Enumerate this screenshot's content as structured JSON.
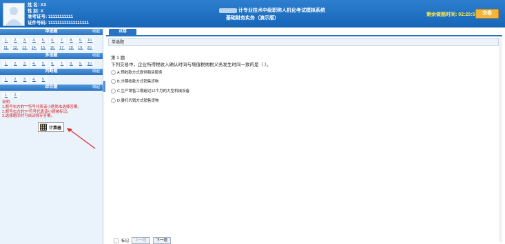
{
  "candidate": {
    "name_line": "姓    名: XX",
    "gender_line": "性    别: X",
    "ticket_line": "准考证号: 11111111111",
    "id_line": "证件号码: 111111111111111111"
  },
  "exam": {
    "title_line1": "计专业技术中级职称人机化考试模拟系统",
    "title_line2": "基础财务实务（演示版）"
  },
  "timer": {
    "label": "剩余做题时间:",
    "value": "02:29:54"
  },
  "submit_label": "交卷",
  "sidebar": {
    "sections": [
      {
        "title": "单选题",
        "collapse": "收起"
      },
      {
        "title": "多选题",
        "collapse": "收起"
      },
      {
        "title": "判断题",
        "collapse": "收起"
      },
      {
        "title": "综合题",
        "collapse": "收起"
      }
    ],
    "single_row1": [
      "1.",
      "2.",
      "3.",
      "4.",
      "5.",
      "6.",
      "7.",
      "8.",
      "9.",
      "10."
    ],
    "single_row2": [
      "11.",
      "12.",
      "13.",
      "14.",
      "15.",
      "16.",
      "17.",
      "18.",
      "19.",
      "20."
    ],
    "multi_row1": [
      "1.",
      "2.",
      "3.",
      "4.",
      "5.",
      "6.",
      "7.",
      "8.",
      "9.",
      "10."
    ],
    "judge_row1": [
      "1.",
      "2.",
      "3.",
      "4.",
      "5."
    ],
    "comp_row1": [
      "1.",
      "2."
    ]
  },
  "instructions": {
    "line1": "说明:",
    "line2": "1.题号右方的“*”符号代表该小题尚未选择答案。",
    "line3": "2.题号右方的“F”符号代表该小题被标记。",
    "line4": "3.选择题同时可自动保存答案。"
  },
  "calculator_label": "计算器",
  "tabs": {
    "paper": "试卷"
  },
  "question": {
    "type_label": "单选题",
    "number": "第 1 题",
    "text": "下列交易中，企业所得税收入确认时间与增值税纳税义务发生时间一致的是（ ）。",
    "options": [
      "A.预收款方式提供租赁服务",
      "B.分期收款方式销售货物",
      "C.生产销售工期超过12个月的大型机械设备",
      "D.委托代销方式销售货物"
    ]
  },
  "bottom": {
    "mark_label": "标记",
    "prev_label": "上一题",
    "next_label": "下一题"
  }
}
